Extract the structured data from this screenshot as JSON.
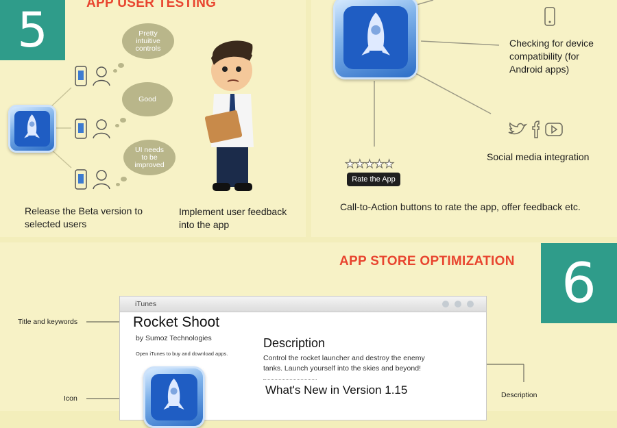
{
  "colors": {
    "accent": "#e8452f",
    "badge": "#2f9c8a",
    "background": "#f3eebb"
  },
  "section5": {
    "number": "5",
    "heading": "APP USER TESTING",
    "clouds": [
      "Pretty intuitive controls",
      "Good",
      "UI needs to be improved"
    ],
    "caption_left": "Release the Beta version to selected users",
    "caption_right": "Implement user feedback into the app"
  },
  "features": {
    "device_compat": "Checking for device compatibility (for Android apps)",
    "social": "Social media integration",
    "rate_button": "Rate the App",
    "cta": "Call-to-Action buttons to rate the app, offer feedback etc.",
    "social_icons": [
      "twitter-icon",
      "facebook-icon",
      "youtube-icon"
    ]
  },
  "section6": {
    "number": "6",
    "heading": "APP STORE OPTIMIZATION",
    "window_title": "iTunes",
    "app_title": "Rocket Shoot",
    "developer": "by Sumoz Technologies",
    "open_itunes": "Open iTunes to buy and download apps.",
    "description_heading": "Description",
    "description_text": "Control the rocket launcher and destroy the enemy tanks. Launch yourself into the skies and beyond!",
    "whats_new": "What's New in Version 1.15",
    "callouts": {
      "title": "Title and keywords",
      "icon": "Icon",
      "description": "Description"
    }
  }
}
